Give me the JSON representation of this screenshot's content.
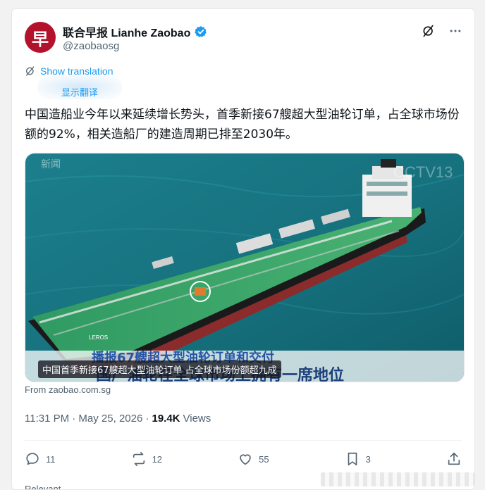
{
  "account": {
    "display_name": "联合早报 Lianhe Zaobao",
    "handle": "@zaobaosg",
    "avatar_glyph": "早",
    "avatar_color": "#b3122c",
    "verified": true
  },
  "header_actions": {
    "grok_icon": "grok-icon",
    "more_icon": "more-icon"
  },
  "translation": {
    "link_label": "Show translation",
    "sub_label": "显示翻译"
  },
  "tweet": {
    "text": "中国造船业今年以来延续增长势头，首季新接67艘超大型油轮订单，占全球市场份额的92%，相关造船厂的建造周期已排至2030年。"
  },
  "media": {
    "caption": "中国首季新接67艘超大型油轮订单 占全球市场份额超九成",
    "watermark": "CCTV13",
    "corner_label": "新闻",
    "bottom_text": "国产油轮在全球市场上拥有一席地位",
    "subtitle_text": "播报67艘超大型油轮订单和交付",
    "ship_name": "LEROS"
  },
  "source": {
    "label": "From zaobao.com.sg"
  },
  "meta": {
    "time_date": "11:31 PM · May 25, 2026 ·",
    "views_count": "19.4K",
    "views_label": "Views"
  },
  "actions": {
    "replies": "11",
    "reposts": "12",
    "likes": "55",
    "bookmarks": "3"
  },
  "footer": {
    "partial_label": "Relevant"
  },
  "colors": {
    "accent": "#1d9bf0",
    "muted": "#536471",
    "text": "#0f1419"
  }
}
